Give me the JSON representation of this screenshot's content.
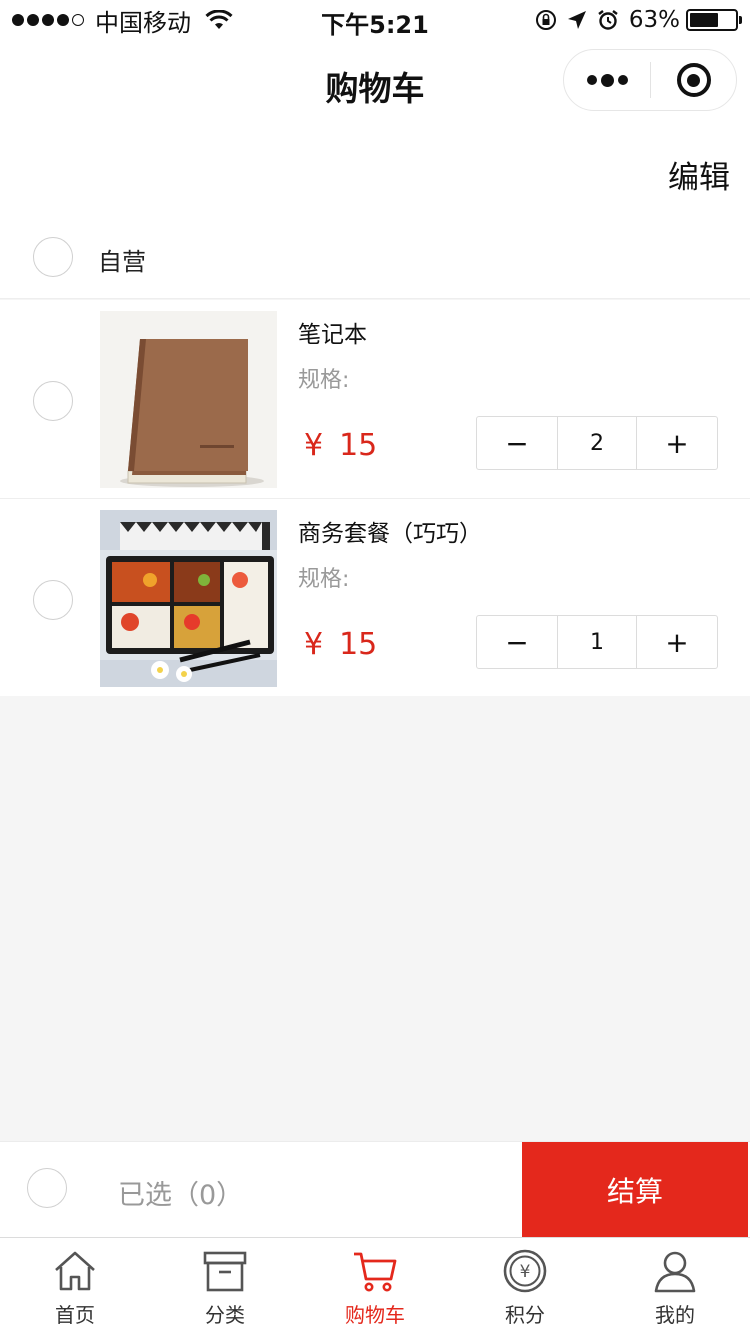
{
  "status_bar": {
    "carrier": "中国移动",
    "time": "下午5:21",
    "battery": "63%",
    "battery_level": 0.63,
    "icons": [
      "signal-dots-icon",
      "wifi-icon",
      "rotation-lock-icon",
      "location-arrow-icon",
      "alarm-icon",
      "battery-icon"
    ]
  },
  "nav": {
    "title": "购物车",
    "capsule_icons": [
      "more-dots-icon",
      "close-target-icon"
    ]
  },
  "edit_label": "编辑",
  "shop": {
    "name": "自营"
  },
  "items": [
    {
      "name": "笔记本",
      "spec": "规格:",
      "currency": "¥",
      "price": "15",
      "quantity": "2",
      "minus": "−",
      "plus": "+",
      "image": "brown-notebook"
    },
    {
      "name": "商务套餐（巧巧）",
      "spec": "规格:",
      "currency": "¥",
      "price": "15",
      "quantity": "1",
      "minus": "−",
      "plus": "+",
      "image": "bento-lunch-box"
    }
  ],
  "checkout": {
    "selected_label": "已选（0）",
    "button_label": "结算"
  },
  "tabs": [
    {
      "label": "首页",
      "icon": "home-icon"
    },
    {
      "label": "分类",
      "icon": "box-icon"
    },
    {
      "label": "购物车",
      "icon": "cart-icon",
      "active": true
    },
    {
      "label": "积分",
      "icon": "points-coin-icon"
    },
    {
      "label": "我的",
      "icon": "user-icon"
    }
  ],
  "colors": {
    "accent": "#e4281c",
    "price": "#d9271b",
    "background": "#f5f5f5"
  }
}
